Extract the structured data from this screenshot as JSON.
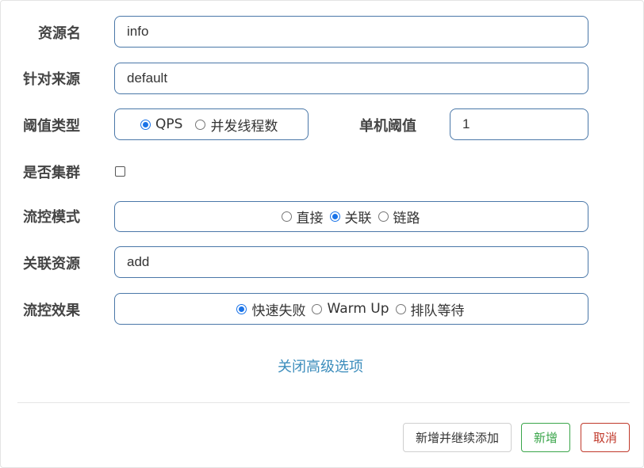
{
  "form": {
    "resource_name": {
      "label": "资源名",
      "value": "info"
    },
    "limit_app": {
      "label": "针对来源",
      "value": "default"
    },
    "grade": {
      "label": "阈值类型",
      "options": [
        "QPS",
        "并发线程数"
      ],
      "selected": "QPS"
    },
    "threshold": {
      "label": "单机阈值",
      "value": "1"
    },
    "cluster": {
      "label": "是否集群",
      "checked": false
    },
    "strategy": {
      "label": "流控模式",
      "options": [
        "直接",
        "关联",
        "链路"
      ],
      "selected": "关联"
    },
    "ref_resource": {
      "label": "关联资源",
      "value": "add"
    },
    "control_behavior": {
      "label": "流控效果",
      "options": [
        "快速失败",
        "Warm Up",
        "排队等待"
      ],
      "selected": "快速失败"
    }
  },
  "advanced_link": "关闭高级选项",
  "footer": {
    "add_continue": "新增并继续添加",
    "add": "新增",
    "cancel": "取消"
  },
  "colors": {
    "border": "#4a77a8",
    "link": "#3c8dbc",
    "add": "#3aa54a",
    "cancel": "#c0392b",
    "radio": "#1a73e8"
  }
}
